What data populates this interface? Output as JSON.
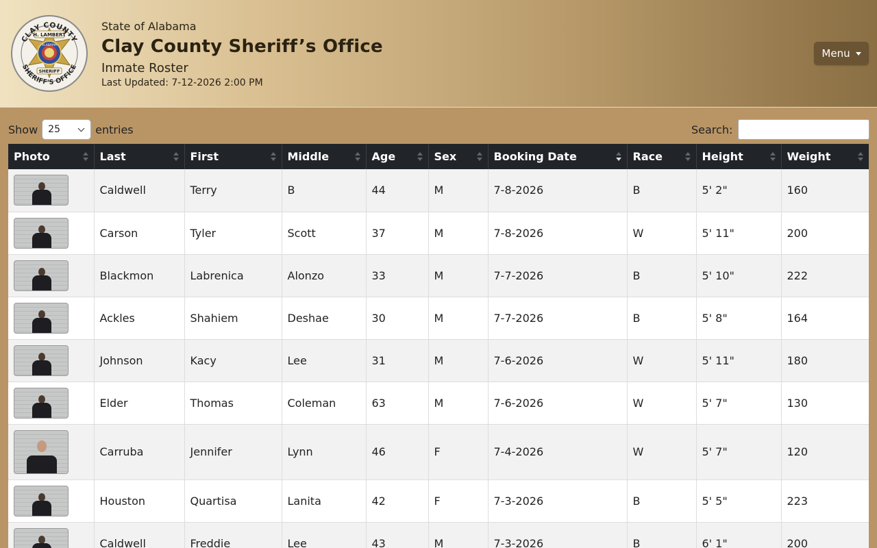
{
  "header": {
    "badge_text_top": "CLAY COUNTY",
    "badge_text_bottom": "SHERIFF'S OFFICE",
    "badge_name": "H. LAMBERT",
    "badge_center": "ALABAMA",
    "badge_rank": "SHERIFF",
    "state": "State of Alabama",
    "office": "Clay County Sheriff’s Office",
    "subtitle": "Inmate Roster",
    "updated": "Last Updated: 7-12-2026 2:00 PM",
    "menu_label": "Menu"
  },
  "controls": {
    "show_label": "Show",
    "entries_value": "25",
    "entries_label": "entries",
    "search_label": "Search:",
    "search_value": ""
  },
  "table": {
    "columns": [
      "Photo",
      "Last",
      "First",
      "Middle",
      "Age",
      "Sex",
      "Booking Date",
      "Race",
      "Height",
      "Weight"
    ],
    "sorted_column": "Booking Date",
    "rows": [
      {
        "last": "Caldwell",
        "first": "Terry",
        "middle": "B",
        "age": "44",
        "sex": "M",
        "booking": "7-8-2026",
        "race": "B",
        "height": "5' 2\"",
        "weight": "160"
      },
      {
        "last": "Carson",
        "first": "Tyler",
        "middle": "Scott",
        "age": "37",
        "sex": "M",
        "booking": "7-8-2026",
        "race": "W",
        "height": "5' 11\"",
        "weight": "200"
      },
      {
        "last": "Blackmon",
        "first": "Labrenica",
        "middle": "Alonzo",
        "age": "33",
        "sex": "M",
        "booking": "7-7-2026",
        "race": "B",
        "height": "5' 10\"",
        "weight": "222"
      },
      {
        "last": "Ackles",
        "first": "Shahiem",
        "middle": "Deshae",
        "age": "30",
        "sex": "M",
        "booking": "7-7-2026",
        "race": "B",
        "height": "5' 8\"",
        "weight": "164"
      },
      {
        "last": "Johnson",
        "first": "Kacy",
        "middle": "Lee",
        "age": "31",
        "sex": "M",
        "booking": "7-6-2026",
        "race": "W",
        "height": "5' 11\"",
        "weight": "180"
      },
      {
        "last": "Elder",
        "first": "Thomas",
        "middle": "Coleman",
        "age": "63",
        "sex": "M",
        "booking": "7-6-2026",
        "race": "W",
        "height": "5' 7\"",
        "weight": "130"
      },
      {
        "last": "Carruba",
        "first": "Jennifer",
        "middle": "Lynn",
        "age": "46",
        "sex": "F",
        "booking": "7-4-2026",
        "race": "W",
        "height": "5' 7\"",
        "weight": "120"
      },
      {
        "last": "Houston",
        "first": "Quartisa",
        "middle": "Lanita",
        "age": "42",
        "sex": "F",
        "booking": "7-3-2026",
        "race": "B",
        "height": "5' 5\"",
        "weight": "223"
      },
      {
        "last": "Caldwell",
        "first": "Freddie",
        "middle": "Lee",
        "age": "43",
        "sex": "M",
        "booking": "7-3-2026",
        "race": "B",
        "height": "6' 1\"",
        "weight": "200"
      }
    ]
  }
}
